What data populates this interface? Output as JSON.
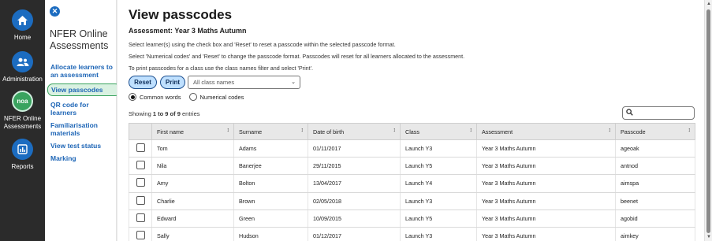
{
  "rail": {
    "home_label": "Home",
    "admin_label": "Administration",
    "nfer_label": "NFER Online Assessments",
    "nfer_logo_text": "noa",
    "reports_label": "Reports"
  },
  "subnav": {
    "title": "NFER Online Assessments",
    "close_glyph": "✕",
    "items": [
      {
        "label": "Allocate learners to an assessment"
      },
      {
        "label": "View passcodes"
      },
      {
        "label": "QR code for learners"
      },
      {
        "label": "Familiarisation materials"
      },
      {
        "label": "View test status"
      },
      {
        "label": "Marking"
      }
    ]
  },
  "main": {
    "title": "View passcodes",
    "assessment_line": "Assessment: Year 3 Maths Autumn",
    "instructions": [
      "Select learner(s) using the check box and 'Reset' to reset a passcode within the selected passcode format.",
      "Select 'Numerical codes' and 'Reset' to change the passcode format. Passcodes will reset for all learners allocated to the assessment.",
      "To print passcodes for a class use the class names filter and select 'Print'."
    ],
    "reset_label": "Reset",
    "print_label": "Print",
    "class_filter_value": "All class names",
    "radio_common": "Common words",
    "radio_numerical": "Numerical codes",
    "showing_prefix": "Showing",
    "showing_range": "1 to 9 of 9",
    "showing_suffix": "entries",
    "search_value": ""
  },
  "table": {
    "headers": [
      "First name",
      "Surname",
      "Date of birth",
      "Class",
      "Assessment",
      "Passcode"
    ],
    "rows": [
      [
        "Tom",
        "Adams",
        "01/11/2017",
        "Launch Y3",
        "Year 3 Maths Autumn",
        "ageoak"
      ],
      [
        "Nila",
        "Banerjee",
        "29/11/2015",
        "Launch Y5",
        "Year 3 Maths Autumn",
        "antnod"
      ],
      [
        "Amy",
        "Bolton",
        "13/04/2017",
        "Launch Y4",
        "Year 3 Maths Autumn",
        "aimspa"
      ],
      [
        "Charlie",
        "Brown",
        "02/05/2018",
        "Launch Y3",
        "Year 3 Maths Autumn",
        "beenet"
      ],
      [
        "Edward",
        "Green",
        "10/09/2015",
        "Launch Y5",
        "Year 3 Maths Autumn",
        "agobid"
      ],
      [
        "Sally",
        "Hudson",
        "01/12/2017",
        "Launch Y3",
        "Year 3 Maths Autumn",
        "aimkey"
      ]
    ]
  },
  "colors": {
    "rail_bg": "#2b2b2b",
    "accent_blue": "#1c6cc0",
    "accent_green": "#3aa35f",
    "active_bg": "#d9f1e1"
  }
}
